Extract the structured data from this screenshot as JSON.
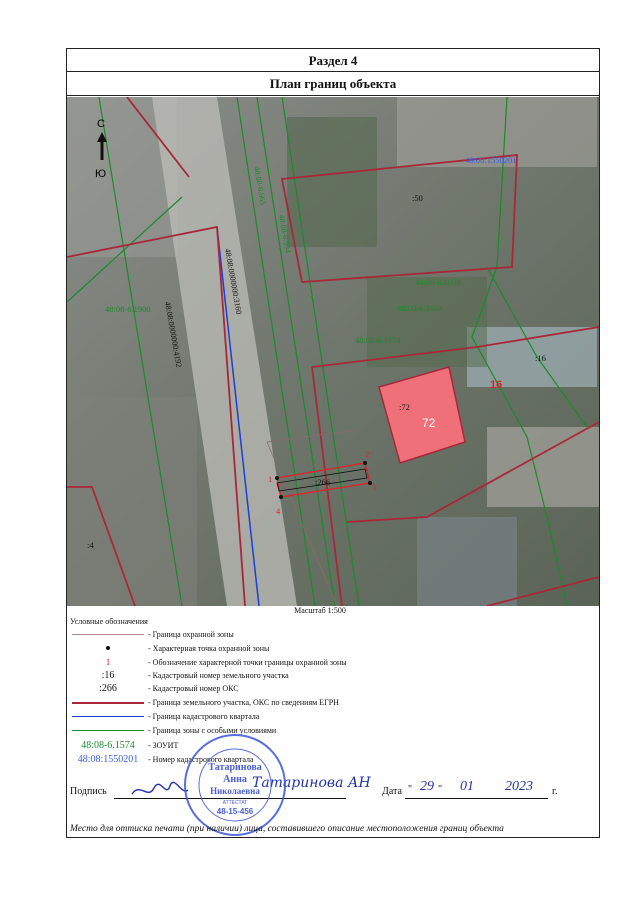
{
  "section_title": "Раздел 4",
  "plan_title": "План границ объекта",
  "compass": {
    "north": "С",
    "south": "Ю"
  },
  "map_labels": {
    "quarter_top": "48:08:1550201",
    "parcel_50": ":50",
    "zone_1898": "48:08-6.1898",
    "zone_1904": "48:08-6.1904",
    "zone_1574": "48:08-6.1574",
    "zone_1900": "48:08-6.1900",
    "parcel_16": ":16",
    "parcel_72": ":72",
    "oks_72": "72",
    "point_16": "16",
    "oks_266": ":266",
    "parcel_4": ":4",
    "road_3160": "48:08:0000000:3160",
    "road_4192": "48:08:0000000:4192",
    "zone_665": "48:08-6.665",
    "zone_994": "48:08-6.994",
    "pt1": "1",
    "pt2": "2",
    "pt3": "3",
    "pt4": "4"
  },
  "scale": "Масштаб 1:500",
  "legend": {
    "title": "Условные обозначения",
    "items": [
      {
        "text": "- Граница охранной зоны"
      },
      {
        "text": "- Характерная точка охранной зоны"
      },
      {
        "symbol": "1",
        "text": "- Обозначение характерной точки границы охранной зоны"
      },
      {
        "symbol": ":16",
        "text": "- Кадастровый номер земельного участка"
      },
      {
        "symbol": ":266",
        "text": "- Кадастровый номер ОКС"
      },
      {
        "text": "- Граница земельного участка, ОКС по сведениям ЕГРН"
      },
      {
        "text": "- Граница кадастрового квартала"
      },
      {
        "text": "- Граница зоны с особыми условиями"
      },
      {
        "symbol": "48:08-6.1574",
        "text": "- ЗОУИТ"
      },
      {
        "symbol": "48:08:1550201",
        "text": "- Номер кадастрового квартала"
      }
    ]
  },
  "signature": {
    "label": "Подпись",
    "name_handwritten": "Татаринова АН",
    "date_label": "Дата",
    "day": "29",
    "month": "01",
    "year": "2023",
    "year_suffix": "г."
  },
  "stamp": {
    "name": "Татаринова Анна Николаевна",
    "attestat": "АТТЕСТАТ",
    "number": "48-15-456"
  },
  "footer": "Место для оттиска печати (при наличии) лица, составившего описание местоположения границ объекта",
  "colors": {
    "parcel": "#a8283a",
    "zone_red": "#e0202a",
    "quarter": "#1b3fd6",
    "zouit": "#1c8a2c",
    "oks_fill": "#f0707a"
  }
}
